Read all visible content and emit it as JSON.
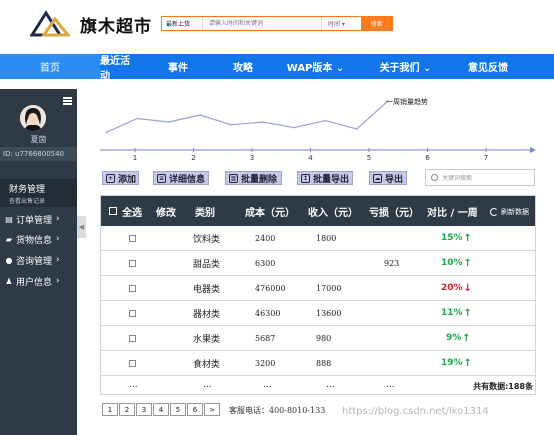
{
  "header": {
    "brand": "旗木超市",
    "search": {
      "category": "最新上货",
      "placeholder": "请输入时间和关键词",
      "time_select": "时间 ▾",
      "button": "搜索"
    }
  },
  "nav": {
    "items": [
      "首页",
      "最近活动",
      "事件",
      "攻略",
      "WAP版本 ⌄",
      "关于我们 ⌄",
      "意见反馈"
    ]
  },
  "sidebar": {
    "username": "夏茵",
    "user_id": "ID: u7766800540",
    "section": {
      "title": "财务管理",
      "subtitle": "查看出售记录"
    },
    "items": [
      {
        "label": "订单管理",
        "icon": "clipboard-icon"
      },
      {
        "label": "货物信息",
        "icon": "truck-icon"
      },
      {
        "label": "咨询管理",
        "icon": "chat-icon"
      },
      {
        "label": "用户信息",
        "icon": "users-icon"
      }
    ]
  },
  "chart_data": {
    "type": "line",
    "title": "一周销量趋势",
    "x": [
      "1",
      "2",
      "3",
      "4",
      "5",
      "6",
      "7"
    ],
    "series": [
      {
        "values": [
          25,
          45,
          40,
          50,
          36,
          40,
          32,
          42,
          30,
          70
        ]
      }
    ],
    "grid": false
  },
  "toolbar": {
    "buttons": [
      {
        "label": "添加",
        "icon": "plus-icon"
      },
      {
        "label": "详细信息",
        "icon": "list-icon"
      },
      {
        "label": "批量删除",
        "icon": "trash-icon"
      },
      {
        "label": "批量导出",
        "icon": "export-icon"
      },
      {
        "label": "导出",
        "icon": "cloud-icon"
      }
    ],
    "search_placeholder": "关键词搜索"
  },
  "table": {
    "headers": [
      "全选",
      "修改",
      "类别",
      "成本（元）",
      "收入（元）",
      "亏损（元）",
      "对比 / 一周"
    ],
    "refresh_label": "刷新数据",
    "rows": [
      {
        "category": "饮料类",
        "cost": "2400",
        "income": "1800",
        "loss": "",
        "pct": "15%",
        "trend": "up"
      },
      {
        "category": "甜品类",
        "cost": "6300",
        "income": "",
        "loss": "923",
        "pct": "10%",
        "trend": "up"
      },
      {
        "category": "电器类",
        "cost": "476000",
        "income": "17000",
        "loss": "",
        "pct": "20%",
        "trend": "down"
      },
      {
        "category": "器材类",
        "cost": "46300",
        "income": "13600",
        "loss": "",
        "pct": "11%",
        "trend": "up"
      },
      {
        "category": "水果类",
        "cost": "5687",
        "income": "980",
        "loss": "",
        "pct": "9%",
        "trend": "up"
      },
      {
        "category": "食材类",
        "cost": "3200",
        "income": "888",
        "loss": "",
        "pct": "19%",
        "trend": "up"
      }
    ],
    "ellipsis": "...",
    "total": "共有数据:188条"
  },
  "pager": {
    "pages": [
      "1",
      "2",
      "3",
      "4",
      "5",
      "6",
      ">"
    ]
  },
  "footer": {
    "phone": "客服电话：400-8010-133",
    "watermark": "https://blog.csdn.net/lko1314"
  },
  "colors": {
    "nav": "#1176e8",
    "sidebar": "#2e3a46",
    "accent": "#ff7a1a",
    "up": "#1aa846",
    "down": "#d0202a"
  }
}
